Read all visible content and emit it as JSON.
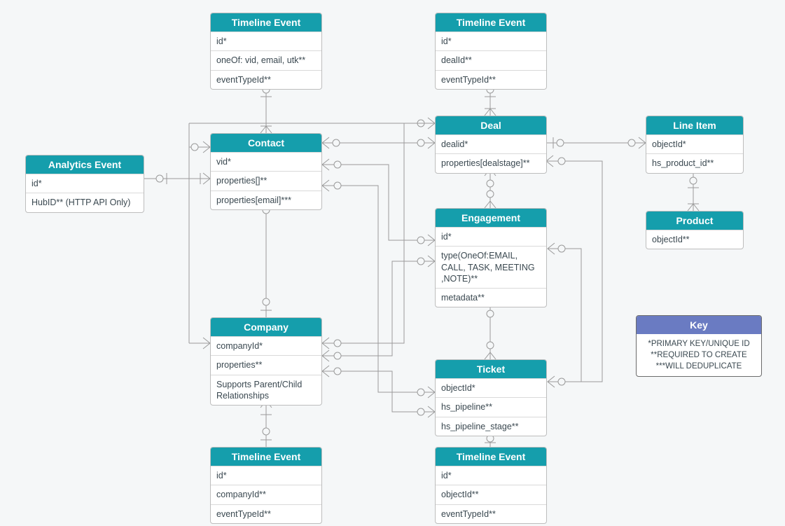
{
  "entities": {
    "timelineEvent1": {
      "title": "Timeline Event",
      "rows": [
        "id*",
        "oneOf: vid, email, utk**",
        "eventTypeId**"
      ]
    },
    "timelineEvent2": {
      "title": "Timeline Event",
      "rows": [
        "id*",
        "dealId**",
        "eventTypeId**"
      ]
    },
    "analyticsEvent": {
      "title": "Analytics Event",
      "rows": [
        "id*",
        "HubID** (HTTP API Only)"
      ]
    },
    "contact": {
      "title": "Contact",
      "rows": [
        "vid*",
        "properties[]**",
        "properties[email]***"
      ]
    },
    "deal": {
      "title": "Deal",
      "rows": [
        "dealid*",
        "properties[dealstage]**"
      ]
    },
    "lineItem": {
      "title": "Line Item",
      "rows": [
        "objectId*",
        "hs_product_id**"
      ]
    },
    "product": {
      "title": "Product",
      "rows": [
        "objectId**"
      ]
    },
    "engagement": {
      "title": "Engagement",
      "rows": [
        "id*",
        "type(OneOf:EMAIL, CALL, TASK, MEETING ,NOTE)**",
        "metadata**"
      ]
    },
    "company": {
      "title": "Company",
      "rows": [
        "companyId*",
        "properties**",
        "Supports Parent/Child Relationships"
      ]
    },
    "ticket": {
      "title": "Ticket",
      "rows": [
        "objectId*",
        "hs_pipeline**",
        "hs_pipeline_stage**"
      ]
    },
    "timelineEvent3": {
      "title": "Timeline Event",
      "rows": [
        "id*",
        "companyId**",
        "eventTypeId**"
      ]
    },
    "timelineEvent4": {
      "title": "Timeline Event",
      "rows": [
        "id*",
        "objectId**",
        "eventTypeId**"
      ]
    }
  },
  "key": {
    "title": "Key",
    "lines": [
      "*PRIMARY KEY/UNIQUE ID",
      "**REQUIRED TO CREATE",
      "***WILL DEDUPLICATE"
    ]
  },
  "colors": {
    "entityHeader": "#159eac",
    "keyHeader": "#6a7bc2",
    "background": "#f5f7f8"
  }
}
